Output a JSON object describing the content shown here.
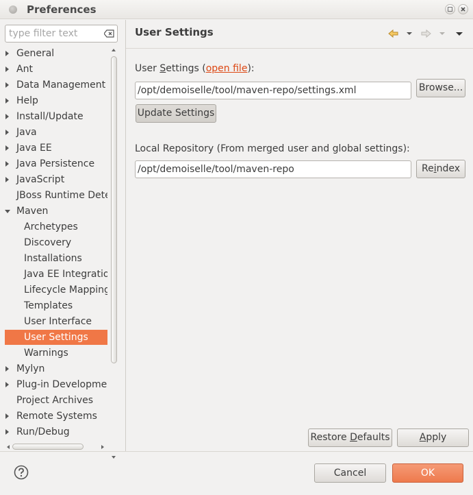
{
  "window": {
    "title": "Preferences"
  },
  "filter": {
    "placeholder": "type filter text"
  },
  "tree": {
    "items": [
      {
        "label": "General",
        "expand": "right",
        "child": false,
        "selected": false
      },
      {
        "label": "Ant",
        "expand": "right",
        "child": false,
        "selected": false
      },
      {
        "label": "Data Management",
        "expand": "right",
        "child": false,
        "selected": false
      },
      {
        "label": "Help",
        "expand": "right",
        "child": false,
        "selected": false
      },
      {
        "label": "Install/Update",
        "expand": "right",
        "child": false,
        "selected": false
      },
      {
        "label": "Java",
        "expand": "right",
        "child": false,
        "selected": false
      },
      {
        "label": "Java EE",
        "expand": "right",
        "child": false,
        "selected": false
      },
      {
        "label": "Java Persistence",
        "expand": "right",
        "child": false,
        "selected": false
      },
      {
        "label": "JavaScript",
        "expand": "right",
        "child": false,
        "selected": false
      },
      {
        "label": "JBoss Runtime Dete",
        "expand": "none",
        "child": false,
        "selected": false
      },
      {
        "label": "Maven",
        "expand": "down",
        "child": false,
        "selected": false
      },
      {
        "label": "Archetypes",
        "expand": "none",
        "child": true,
        "selected": false
      },
      {
        "label": "Discovery",
        "expand": "none",
        "child": true,
        "selected": false
      },
      {
        "label": "Installations",
        "expand": "none",
        "child": true,
        "selected": false
      },
      {
        "label": "Java EE Integration",
        "expand": "none",
        "child": true,
        "selected": false
      },
      {
        "label": "Lifecycle Mapping",
        "expand": "none",
        "child": true,
        "selected": false
      },
      {
        "label": "Templates",
        "expand": "none",
        "child": true,
        "selected": false
      },
      {
        "label": "User Interface",
        "expand": "none",
        "child": true,
        "selected": false
      },
      {
        "label": "User Settings",
        "expand": "none",
        "child": true,
        "selected": true
      },
      {
        "label": "Warnings",
        "expand": "none",
        "child": true,
        "selected": false
      },
      {
        "label": "Mylyn",
        "expand": "right",
        "child": false,
        "selected": false
      },
      {
        "label": "Plug-in Developmen",
        "expand": "right",
        "child": false,
        "selected": false
      },
      {
        "label": "Project Archives",
        "expand": "none",
        "child": false,
        "selected": false
      },
      {
        "label": "Remote Systems",
        "expand": "right",
        "child": false,
        "selected": false
      },
      {
        "label": "Run/Debug",
        "expand": "right",
        "child": false,
        "selected": false
      }
    ]
  },
  "page": {
    "title": "User Settings",
    "user_settings_label_pre": "User ",
    "user_settings_label_mnemonic": "S",
    "user_settings_label_post": "ettings (",
    "open_file_link": "open file",
    "user_settings_label_end": "):",
    "user_settings_path": "/opt/demoiselle/tool/maven-repo/settings.xml",
    "browse_button": "Browse...",
    "update_button": "Update Settings",
    "local_repo_label": "Local Repository (From merged user and global settings):",
    "local_repo_path": "/opt/demoiselle/tool/maven-repo",
    "reindex_button_pre": "Re",
    "reindex_button_mnemonic": "i",
    "reindex_button_post": "ndex",
    "restore_defaults_pre": "Restore ",
    "restore_defaults_mnemonic": "D",
    "restore_defaults_post": "efaults",
    "apply_mnemonic": "A",
    "apply_post": "pply"
  },
  "footer": {
    "cancel_button": "Cancel",
    "ok_button": "OK"
  },
  "colors": {
    "accent": "#f07746",
    "link": "#dd4814",
    "ok_button": "#ee7a4d"
  },
  "icons": {
    "window": "window-circle-icon",
    "clear": "clear-filter-icon",
    "back": "back-arrow-icon",
    "forward": "forward-arrow-icon",
    "menu": "view-menu-icon",
    "help": "help-icon"
  }
}
